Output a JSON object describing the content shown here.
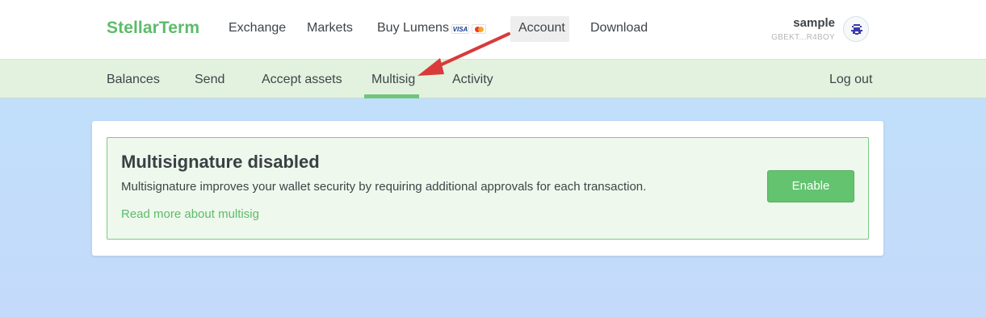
{
  "header": {
    "brand": "StellarTerm",
    "nav": {
      "exchange": "Exchange",
      "markets": "Markets",
      "buy_lumens": "Buy Lumens",
      "account": "Account",
      "download": "Download"
    },
    "payment_icons": {
      "visa": "VISA",
      "mastercard": "mastercard-icon"
    },
    "user": {
      "name": "sample",
      "public_key": "GBEKT...R4BOY",
      "avatar_icon": "identicon-icon"
    }
  },
  "subnav": {
    "items": [
      "Balances",
      "Send",
      "Accept assets",
      "Multisig",
      "Activity"
    ],
    "active": "Multisig",
    "logout": "Log out"
  },
  "multisig": {
    "title": "Multisignature disabled",
    "description": "Multisignature improves your wallet security by requiring additional approvals for each transaction.",
    "read_more": "Read more about multisig",
    "enable_button": "Enable"
  },
  "annotation": {
    "type": "arrow",
    "color": "#d93a3a"
  },
  "colors": {
    "brand": "#5dbb6b",
    "subnav_bg": "#e3f2de",
    "notice_bg": "#eef8ec",
    "button": "#63c36f"
  }
}
